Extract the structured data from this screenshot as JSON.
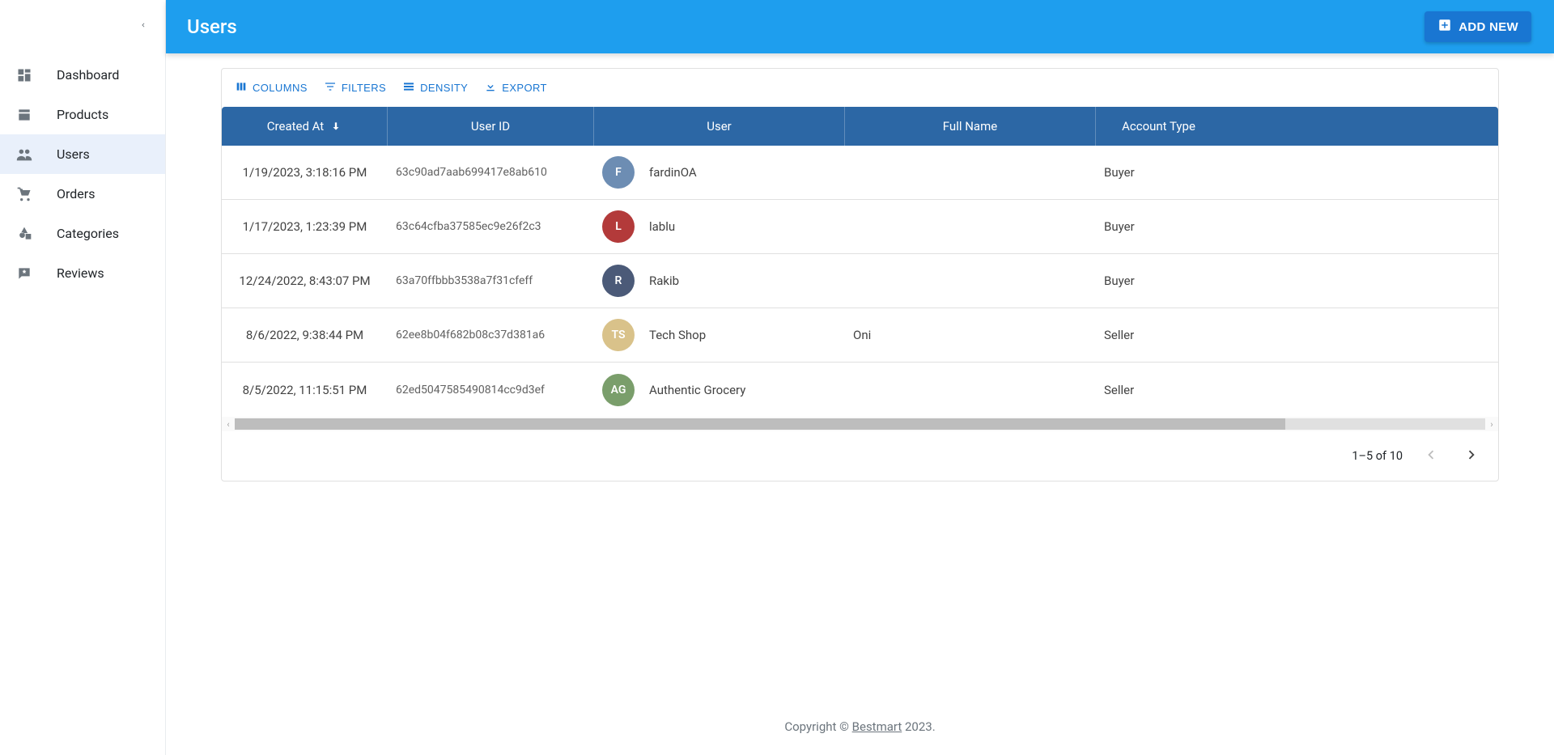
{
  "sidebar": {
    "items": [
      {
        "label": "Dashboard",
        "icon": "dashboard"
      },
      {
        "label": "Products",
        "icon": "products"
      },
      {
        "label": "Users",
        "icon": "users",
        "active": true
      },
      {
        "label": "Orders",
        "icon": "orders"
      },
      {
        "label": "Categories",
        "icon": "categories"
      },
      {
        "label": "Reviews",
        "icon": "reviews"
      }
    ]
  },
  "header": {
    "title": "Users",
    "add_label": "ADD NEW"
  },
  "toolbar": {
    "columns": "COLUMNS",
    "filters": "FILTERS",
    "density": "DENSITY",
    "export": "EXPORT"
  },
  "table": {
    "columns": {
      "created_at": "Created At",
      "user_id": "User ID",
      "user": "User",
      "full_name": "Full Name",
      "account_type": "Account Type"
    },
    "rows": [
      {
        "created_at": "1/19/2023, 3:18:16 PM",
        "user_id": "63c90ad7aab699417e8ab610",
        "user": "fardinOA",
        "full_name": "",
        "account_type": "Buyer",
        "avatar_color": "#6d8db3"
      },
      {
        "created_at": "1/17/2023, 1:23:39 PM",
        "user_id": "63c64cfba37585ec9e26f2c3",
        "user": "lablu",
        "full_name": "",
        "account_type": "Buyer",
        "avatar_color": "#b33a3a"
      },
      {
        "created_at": "12/24/2022, 8:43:07 PM",
        "user_id": "63a70ffbbb3538a7f31cfeff",
        "user": "Rakib",
        "full_name": "",
        "account_type": "Buyer",
        "avatar_color": "#4b5a78"
      },
      {
        "created_at": "8/6/2022, 9:38:44 PM",
        "user_id": "62ee8b04f682b08c37d381a6",
        "user": "Tech Shop",
        "full_name": "Oni",
        "account_type": "Seller",
        "avatar_color": "#d9c28a"
      },
      {
        "created_at": "8/5/2022, 11:15:51 PM",
        "user_id": "62ed5047585490814cc9d3ef",
        "user": "Authentic Grocery",
        "full_name": "",
        "account_type": "Seller",
        "avatar_color": "#7a9e6b"
      }
    ]
  },
  "pagination": {
    "range": "1–5 of 10"
  },
  "footer": {
    "prefix": "Copyright © ",
    "link": "Bestmart",
    "suffix": " 2023."
  }
}
